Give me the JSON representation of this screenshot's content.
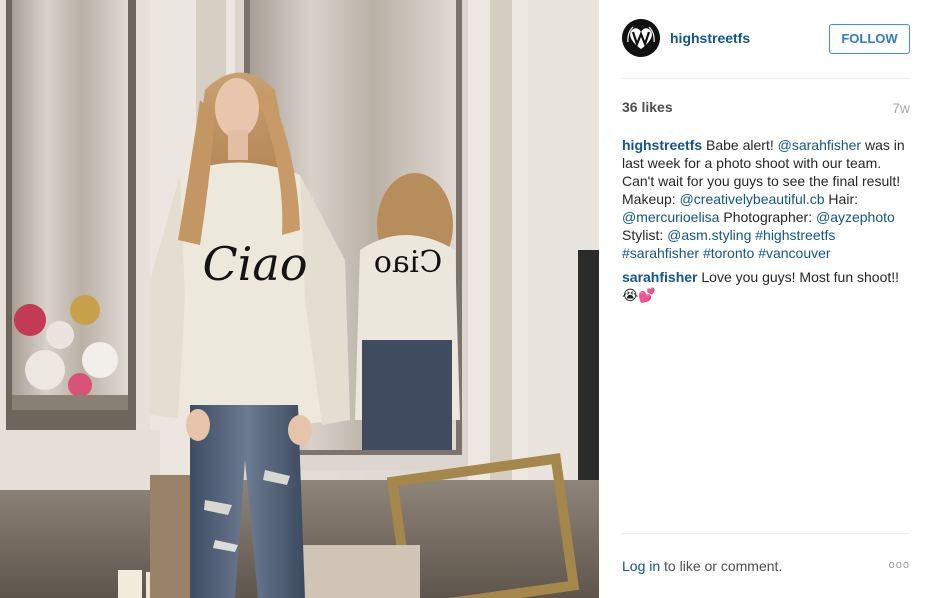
{
  "post": {
    "username": "highstreetfs",
    "follow_label": "FOLLOW",
    "likes": "36 likes",
    "age": "7w",
    "caption": {
      "user": "highstreetfs",
      "parts": [
        {
          "t": "Babe alert! "
        },
        {
          "t": "@sarahfisher",
          "link": true
        },
        {
          "t": " was in last week for a photo shoot with our team. Can't wait for you guys to see the final result! Makeup: "
        },
        {
          "t": "@creativelybeautiful.cb",
          "link": true
        },
        {
          "t": " Hair: "
        },
        {
          "t": "@mercurioelisa",
          "link": true
        },
        {
          "t": " Photographer: "
        },
        {
          "t": "@ayzephoto",
          "link": true
        },
        {
          "t": " Stylist: "
        },
        {
          "t": "@asm.styling",
          "link": true
        },
        {
          "t": " "
        },
        {
          "t": "#highstreetfs",
          "link": true
        },
        {
          "t": " "
        },
        {
          "t": "#sarahfisher",
          "link": true
        },
        {
          "t": " "
        },
        {
          "t": "#toronto",
          "link": true
        },
        {
          "t": " "
        },
        {
          "t": "#vancouver",
          "link": true
        }
      ]
    },
    "reply": {
      "user": "sarahfisher",
      "text": "Love you guys! Most fun shoot!! 😭💕"
    }
  },
  "footer": {
    "login_label": "Log in",
    "login_suffix": " to like or comment.",
    "more_label": "ooo"
  },
  "photo": {
    "sweater_text": "Ciao",
    "mirror_text": "Ciao"
  },
  "colors": {
    "link": "#125688",
    "follow_border": "#4090db",
    "follow_text": "#2f7bc4",
    "separator": "#efefef",
    "muted": "#a5a7aa"
  }
}
